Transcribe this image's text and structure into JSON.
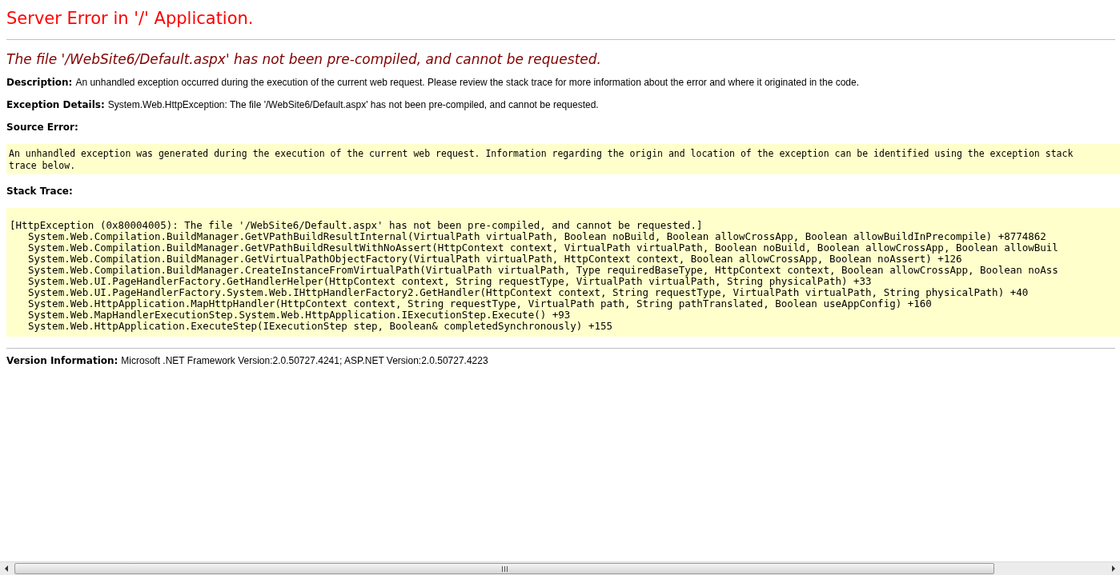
{
  "title": "Server Error in '/' Application.",
  "heading": "The file '/WebSite6/Default.aspx' has not been pre-compiled, and cannot be requested.",
  "description": {
    "label": "Description:",
    "text": "An unhandled exception occurred during the execution of the current web request. Please review the stack trace for more information about the error and where it originated in the code."
  },
  "exception_details": {
    "label": "Exception Details:",
    "text": "System.Web.HttpException: The file '/WebSite6/Default.aspx' has not been pre-compiled, and cannot be requested."
  },
  "source_error": {
    "label": "Source Error:",
    "text": "An unhandled exception was generated during the execution of the current web request. Information regarding the origin and location of the exception can be identified using the exception stack trace below."
  },
  "stack_trace": {
    "label": "Stack Trace:",
    "exception": "[HttpException (0x80004005): The file '/WebSite6/Default.aspx' has not been pre-compiled, and cannot be requested.]",
    "frames": [
      "System.Web.Compilation.BuildManager.GetVPathBuildResultInternal(VirtualPath virtualPath, Boolean noBuild, Boolean allowCrossApp, Boolean allowBuildInPrecompile) +8774862",
      "System.Web.Compilation.BuildManager.GetVPathBuildResultWithNoAssert(HttpContext context, VirtualPath virtualPath, Boolean noBuild, Boolean allowCrossApp, Boolean allowBuil",
      "System.Web.Compilation.BuildManager.GetVirtualPathObjectFactory(VirtualPath virtualPath, HttpContext context, Boolean allowCrossApp, Boolean noAssert) +126",
      "System.Web.Compilation.BuildManager.CreateInstanceFromVirtualPath(VirtualPath virtualPath, Type requiredBaseType, HttpContext context, Boolean allowCrossApp, Boolean noAss",
      "System.Web.UI.PageHandlerFactory.GetHandlerHelper(HttpContext context, String requestType, VirtualPath virtualPath, String physicalPath) +33",
      "System.Web.UI.PageHandlerFactory.System.Web.IHttpHandlerFactory2.GetHandler(HttpContext context, String requestType, VirtualPath virtualPath, String physicalPath) +40",
      "System.Web.HttpApplication.MapHttpHandler(HttpContext context, String requestType, VirtualPath path, String pathTranslated, Boolean useAppConfig) +160",
      "System.Web.MapHandlerExecutionStep.System.Web.HttpApplication.IExecutionStep.Execute() +93",
      "System.Web.HttpApplication.ExecuteStep(IExecutionStep step, Boolean& completedSynchronously) +155"
    ]
  },
  "version_info": {
    "label": "Version Information:",
    "text": "Microsoft .NET Framework Version:2.0.50727.4241; ASP.NET Version:2.0.50727.4223"
  }
}
